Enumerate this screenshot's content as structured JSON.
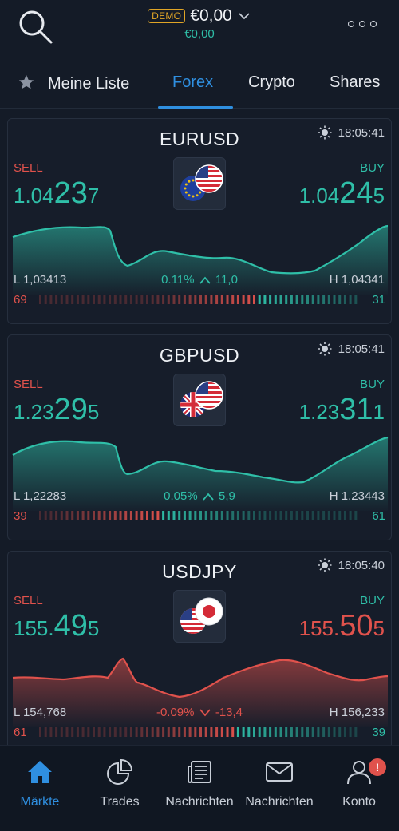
{
  "header": {
    "demo_badge": "DEMO",
    "balance": "€0,00",
    "sub_balance": "€0,00"
  },
  "tabs": [
    {
      "label": "Meine Liste",
      "icon": "star-icon"
    },
    {
      "label": "Forex",
      "active": true
    },
    {
      "label": "Crypto"
    },
    {
      "label": "Shares"
    }
  ],
  "colors": {
    "buy_green": "#2fbfa8",
    "sell_red": "#e0524c",
    "accent_blue": "#2f8fe0",
    "demo_orange": "#e0a526"
  },
  "instruments": [
    {
      "symbol": "EURUSD",
      "time": "18:05:41",
      "sell_label": "SELL",
      "buy_label": "BUY",
      "sell": {
        "a": "1.04",
        "b": "23",
        "c": "7",
        "color": "green"
      },
      "buy": {
        "a": "1.04",
        "b": "24",
        "c": "5",
        "color": "green"
      },
      "low": "L 1,03413",
      "high": "H 1,04341",
      "change_pct": "0.11%",
      "change_pts": "11,0",
      "direction": "up",
      "sentiment_sell": "69",
      "sentiment_buy": "31",
      "flags": [
        "eu-flag-icon",
        "us-flag-icon"
      ]
    },
    {
      "symbol": "GBPUSD",
      "time": "18:05:41",
      "sell_label": "SELL",
      "buy_label": "BUY",
      "sell": {
        "a": "1.23",
        "b": "29",
        "c": "5",
        "color": "green"
      },
      "buy": {
        "a": "1.23",
        "b": "31",
        "c": "1",
        "color": "green"
      },
      "low": "L 1,22283",
      "high": "H 1,23443",
      "change_pct": "0.05%",
      "change_pts": "5,9",
      "direction": "up",
      "sentiment_sell": "39",
      "sentiment_buy": "61",
      "flags": [
        "uk-flag-icon",
        "us-flag-icon"
      ]
    },
    {
      "symbol": "USDJPY",
      "time": "18:05:40",
      "sell_label": "SELL",
      "buy_label": "BUY",
      "sell": {
        "a": "155.",
        "b": "49",
        "c": "5",
        "color": "green"
      },
      "buy": {
        "a": "155.",
        "b": "50",
        "c": "5",
        "color": "red"
      },
      "low": "L 154,768",
      "high": "H 156,233",
      "change_pct": "-0.09%",
      "change_pts": "-13,4",
      "direction": "down",
      "sentiment_sell": "61",
      "sentiment_buy": "39",
      "flags": [
        "us-flag-icon",
        "jp-flag-icon"
      ]
    }
  ],
  "bottom_nav": [
    {
      "label": "Märkte",
      "icon": "home-icon",
      "active": true
    },
    {
      "label": "Trades",
      "icon": "pie-chart-icon"
    },
    {
      "label": "Nachrichten",
      "icon": "newspaper-icon"
    },
    {
      "label": "Nachrichten",
      "icon": "mail-icon"
    },
    {
      "label": "Konto",
      "icon": "user-icon",
      "badge": "!"
    }
  ]
}
